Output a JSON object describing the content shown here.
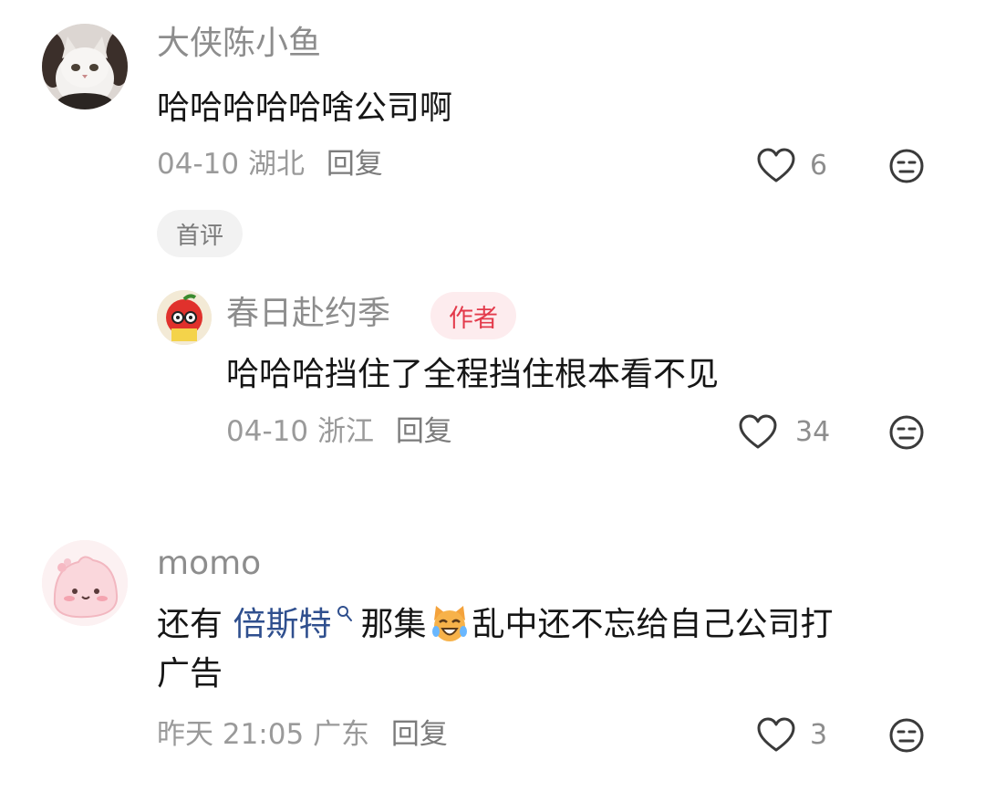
{
  "comments": [
    {
      "user": "大侠陈小鱼",
      "text": "哈哈哈哈哈啥公司啊",
      "date": "04-10",
      "location": "湖北",
      "reply_label": "回复",
      "likes": "6",
      "tag": "首评",
      "avatar_icon": "cat-avatar",
      "replies": [
        {
          "user": "春日赴约季",
          "badge": "作者",
          "text": "哈哈哈挡住了全程挡住根本看不见",
          "date": "04-10",
          "location": "浙江",
          "reply_label": "回复",
          "likes": "34",
          "avatar_icon": "apple-character-avatar"
        }
      ]
    },
    {
      "user": "momo",
      "text_before": "还有",
      "link_text": "倍斯特",
      "text_after1": "那集",
      "text_after2": "乱中还不忘给自己公司打",
      "text_line2": "广告",
      "date": "昨天 21:05",
      "location": "广东",
      "reply_label": "回复",
      "likes": "3",
      "avatar_icon": "pink-blob-avatar"
    }
  ],
  "colors": {
    "name": "#8d8d8d",
    "content": "#161616",
    "meta": "#9a9a9a",
    "link": "#2f4f8e",
    "badge_bg": "#fdecee",
    "badge_text": "#e33a4b",
    "pill_bg": "#f2f2f2"
  }
}
